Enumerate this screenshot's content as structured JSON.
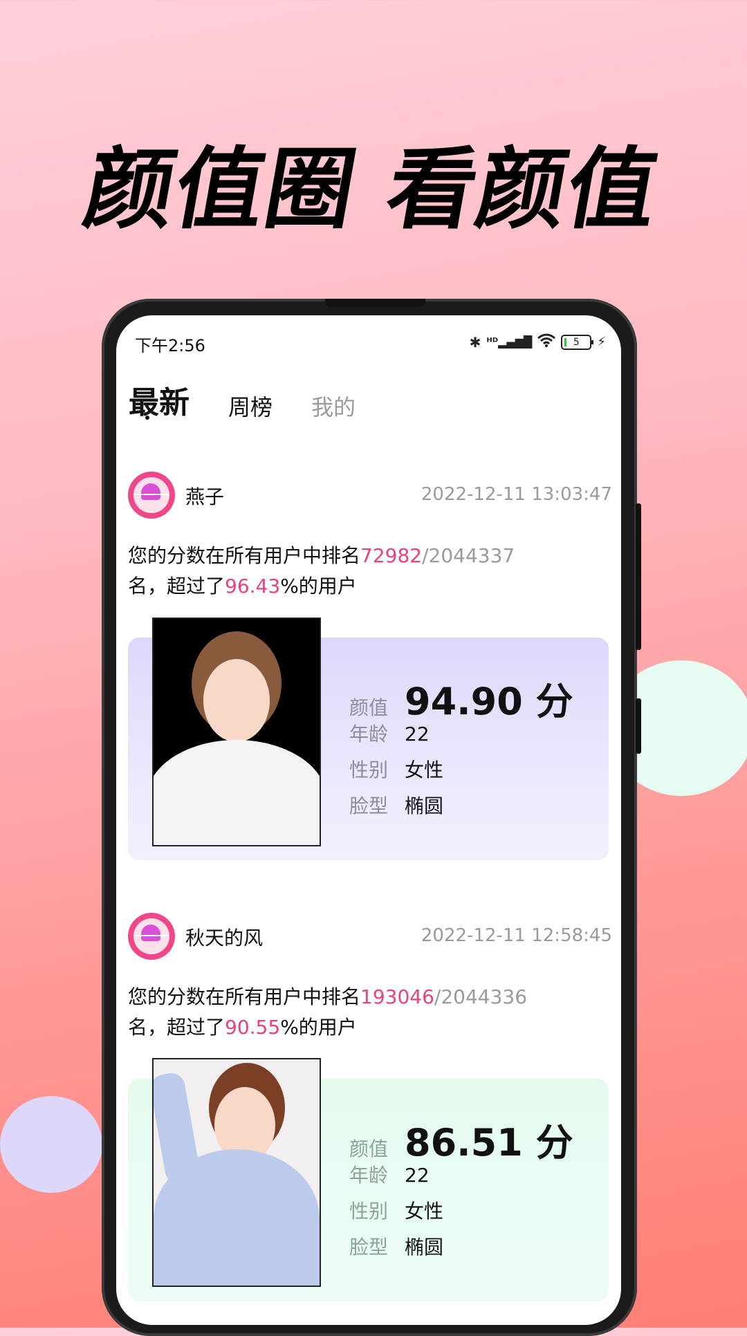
{
  "headline": "颜值圈 看颜值",
  "status_bar": {
    "time": "下午2:56",
    "icons": [
      "bluetooth-icon",
      "hd-signal-icon",
      "wifi-icon",
      "battery-icon",
      "charging-icon"
    ],
    "battery_level": "5"
  },
  "tabs": [
    {
      "label": "最新",
      "active": true
    },
    {
      "label": "周榜",
      "active": false
    },
    {
      "label": "我的",
      "active": false
    }
  ],
  "posts": [
    {
      "username": "燕子",
      "datetime": "2022-12-11 13:03:47",
      "rank_prefix": "您的分数在所有用户中排名",
      "rank": "72982",
      "total": "/2044337",
      "line2_prefix": "名，超过了",
      "percent": "96.43",
      "line2_suffix": "%的用户",
      "score_label": "颜值",
      "score": "94.90 分",
      "age_label": "年龄",
      "age": "22",
      "gender_label": "性别",
      "gender": "女性",
      "face_label": "脸型",
      "face": "椭圆"
    },
    {
      "username": "秋天的风",
      "datetime": "2022-12-11 12:58:45",
      "rank_prefix": "您的分数在所有用户中排名",
      "rank": "193046",
      "total": "/2044336",
      "line2_prefix": "名，超过了",
      "percent": "90.55",
      "line2_suffix": "%的用户",
      "score_label": "颜值",
      "score": "86.51 分",
      "age_label": "年龄",
      "age": "22",
      "gender_label": "性别",
      "gender": "女性",
      "face_label": "脸型",
      "face": "椭圆"
    }
  ],
  "colors": {
    "accent": "#e8417e",
    "card1_bg": "#ddd7fb",
    "card2_bg": "#e3fbed"
  }
}
